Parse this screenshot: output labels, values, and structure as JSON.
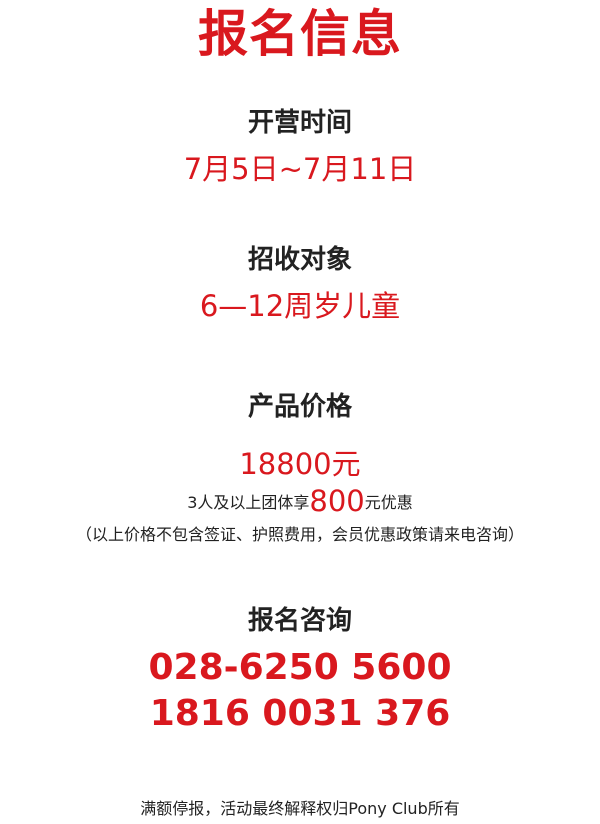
{
  "title": "报名信息",
  "camp_time": {
    "heading": "开营时间",
    "value": "7月5日~7月11日"
  },
  "target": {
    "heading": "招收对象",
    "value": "6—12周岁儿童"
  },
  "price": {
    "heading": "产品价格",
    "value": "18800元",
    "group_prefix": "3人及以上团体享",
    "group_amount": "800",
    "group_suffix": "元优惠",
    "note": "（以上价格不包含签证、护照费用，会员优惠政策请来电咨询）"
  },
  "contact": {
    "heading": "报名咨询",
    "phone_1": "028-6250 5600",
    "phone_2": "1816 0031 376"
  },
  "footer": "满额停报，活动最终解释权归Pony Club所有",
  "colors": {
    "accent_red": "#d9181e",
    "text_dark": "#222222",
    "background": "#ffffff"
  }
}
